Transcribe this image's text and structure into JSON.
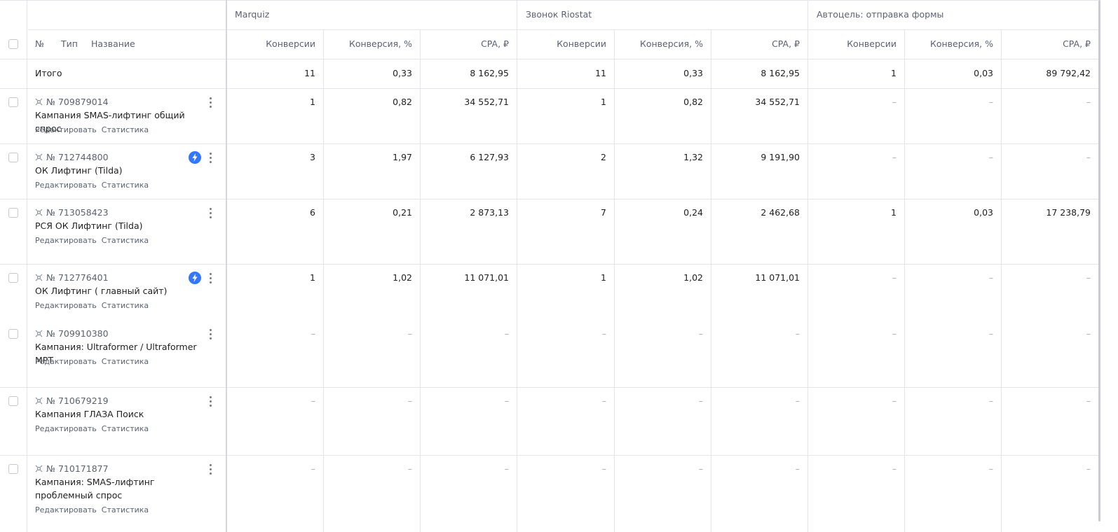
{
  "groups": [
    {
      "label": "Marquiz"
    },
    {
      "label": "Звонок Riostat"
    },
    {
      "label": "Автоцель: отправка формы"
    }
  ],
  "metric_headers": [
    "Конверсии",
    "Конверсия, %",
    "CPA, ₽"
  ],
  "first_header": {
    "no": "№",
    "type": "Тип",
    "name": "Название"
  },
  "totals": {
    "label": "Итого",
    "values": [
      "11",
      "0,33",
      "8 162,95",
      "11",
      "0,33",
      "8 162,95",
      "1",
      "0,03",
      "89 792,42"
    ]
  },
  "row_links": {
    "edit": "Редактировать",
    "stats": "Статистика"
  },
  "campaigns": [
    {
      "id": "№ 709879014",
      "name": "Кампания SMAS-лифтинг общий спрос",
      "bolt": false,
      "values": [
        "1",
        "0,82",
        "34 552,71",
        "1",
        "0,82",
        "34 552,71",
        "–",
        "–",
        "–"
      ]
    },
    {
      "id": "№ 712744800",
      "name": "ОК Лифтинг (Tilda)",
      "bolt": true,
      "values": [
        "3",
        "1,97",
        "6 127,93",
        "2",
        "1,32",
        "9 191,90",
        "–",
        "–",
        "–"
      ]
    },
    {
      "id": "№ 713058423",
      "name": "РСЯ ОК Лифтинг (Tilda)",
      "bolt": false,
      "values": [
        "6",
        "0,21",
        "2 873,13",
        "7",
        "0,24",
        "2 462,68",
        "1",
        "0,03",
        "17 238,79"
      ]
    },
    {
      "id": "№ 712776401",
      "name": "ОК Лифтинг ( главный сайт)",
      "bolt": true,
      "values": [
        "1",
        "1,02",
        "11 071,01",
        "1",
        "1,02",
        "11 071,01",
        "–",
        "–",
        "–"
      ]
    },
    {
      "id": "№ 709910380",
      "name": "Кампания: Ultraformer / Ultraformer MPT",
      "bolt": false,
      "values": [
        "–",
        "–",
        "–",
        "–",
        "–",
        "–",
        "–",
        "–",
        "–"
      ]
    },
    {
      "id": "№ 710679219",
      "name": "Кампания ГЛАЗА Поиск",
      "bolt": false,
      "values": [
        "–",
        "–",
        "–",
        "–",
        "–",
        "–",
        "–",
        "–",
        "–"
      ]
    },
    {
      "id": "№ 710171877",
      "name": "Кампания: SMAS-лифтинг проблемный спрос",
      "bolt": false,
      "values": [
        "–",
        "–",
        "–",
        "–",
        "–",
        "–",
        "–",
        "–",
        "–"
      ]
    }
  ],
  "colors": {
    "accent": "#3377ff",
    "border": "#e3e5ea",
    "muted": "#5b6170"
  }
}
